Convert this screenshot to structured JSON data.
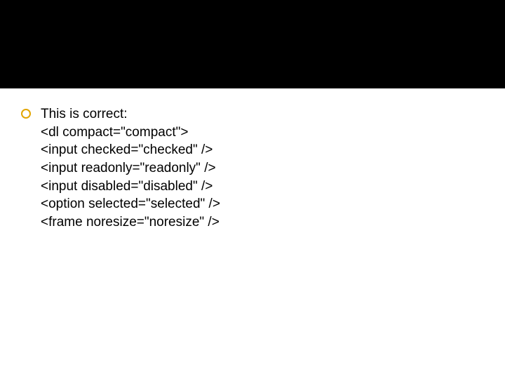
{
  "slide": {
    "bullet": {
      "lead": "This is correct:",
      "lines": [
        "<dl compact=\"compact\">",
        "<input checked=\"checked\" />",
        "<input readonly=\"readonly\" />",
        "<input disabled=\"disabled\" />",
        "<option selected=\"selected\" />",
        "<frame noresize=\"noresize\" />"
      ]
    }
  }
}
